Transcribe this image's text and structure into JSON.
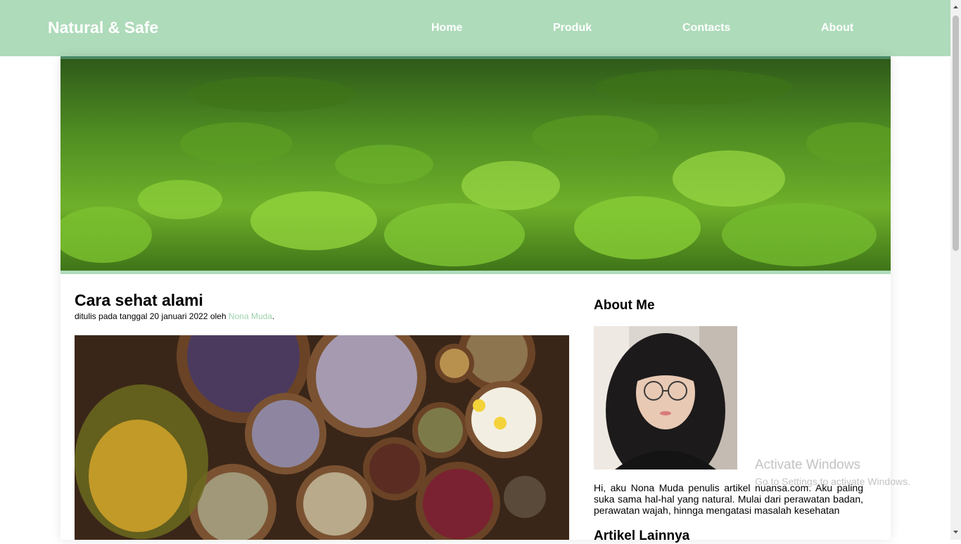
{
  "navbar": {
    "brand": "Natural & Safe",
    "links": [
      "Home",
      "Produk",
      "Contacts",
      "About"
    ],
    "color": "#aedbba"
  },
  "article": {
    "title": "Cara sehat alami",
    "meta_prefix": "ditulis pada tanggal 20 januari 2022 oleh ",
    "author": "Nona Muda",
    "meta_suffix": "."
  },
  "sidebar": {
    "about_title": "About Me",
    "bio": "Hi, aku Nona Muda penulis artikel nuansa.com. Aku paling suka sama hal-hal yang natural. Mulai dari perawatan badan, perawatan wajah, hinnga mengatasi masalah kesehatan",
    "more_title": "Artikel Lainnya"
  },
  "watermark": {
    "title": "Activate Windows",
    "subtitle": "Go to Settings to activate Windows."
  },
  "icons": {
    "scroll_up": "triangle-up-icon",
    "scroll_down": "triangle-down-icon"
  }
}
